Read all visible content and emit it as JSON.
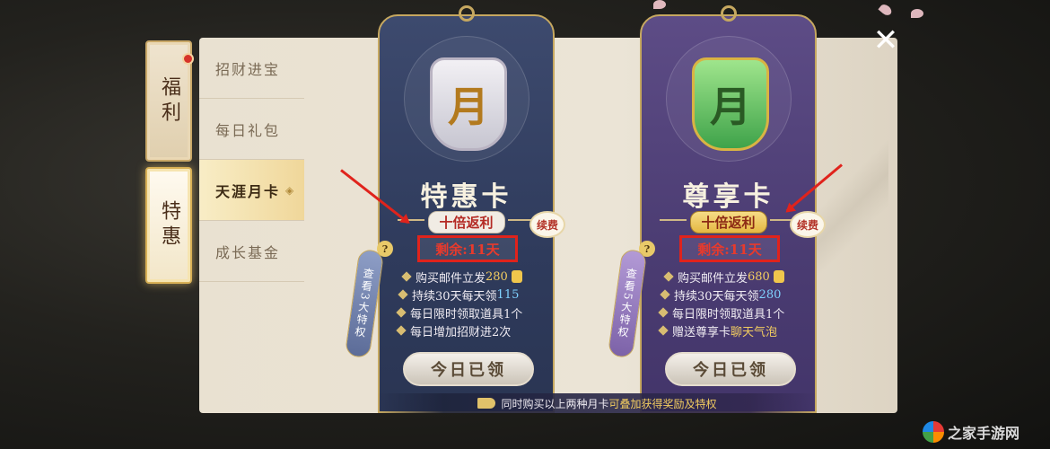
{
  "side_tabs": [
    {
      "label": "福利"
    },
    {
      "label": "特惠"
    }
  ],
  "menu": {
    "items": [
      {
        "label": "招财进宝"
      },
      {
        "label": "每日礼包"
      },
      {
        "label": "天涯月卡"
      },
      {
        "label": "成长基金"
      }
    ],
    "active_index": 2
  },
  "cards": [
    {
      "tag_char": "月",
      "title": "特惠卡",
      "badge": "十倍返利",
      "remaining": "剩余:11天",
      "renew_label": "续费",
      "scroll_text": "查看3大特权",
      "perks": [
        {
          "pre": "购买邮件立发",
          "hl": "280",
          "post": ""
        },
        {
          "pre": "持续30天每天领",
          "hl": "115",
          "post": ""
        },
        {
          "pre": "每日限时领取道具1个",
          "hl": "",
          "post": ""
        },
        {
          "pre": "每日增加招财进",
          "hl": "",
          "post": "2次"
        }
      ],
      "claim_button": "今日已领"
    },
    {
      "tag_char": "月",
      "title": "尊享卡",
      "badge": "十倍返利",
      "remaining": "剩余:11天",
      "renew_label": "续费",
      "scroll_text": "查看5大特权",
      "perks": [
        {
          "pre": "购买邮件立发",
          "hl": "680",
          "post": ""
        },
        {
          "pre": "持续30天每天领",
          "hl": "280",
          "post": ""
        },
        {
          "pre": "每日限时领取道具1个",
          "hl": "",
          "post": ""
        },
        {
          "pre": "赠送尊享卡",
          "hl": "聊天气泡",
          "post": ""
        }
      ],
      "claim_button": "今日已领"
    }
  ],
  "bottom_note": {
    "pre": "同时购买以上两种月卡",
    "hl": "可叠加获得奖励及特权"
  },
  "close_label": "✕",
  "watermark": "之家手游网",
  "colors": {
    "blue_card": "#3d4a6e",
    "purple_card": "#5d4c86",
    "highlight_red": "#e0231c",
    "gold": "#c6a860"
  }
}
